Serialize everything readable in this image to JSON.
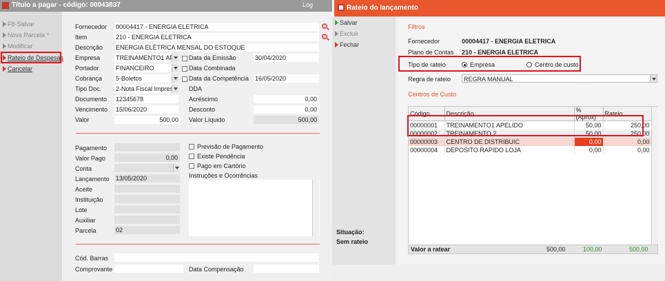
{
  "left": {
    "title": "Título a pagar - código: 00043837",
    "log": "Log",
    "sidebar": [
      {
        "label": "F8-Salvar",
        "state": "disabled"
      },
      {
        "label": "Nova Parcela *",
        "state": "disabled"
      },
      {
        "label": "Modificar",
        "state": "disabled"
      },
      {
        "label": "Rateio de Despesas",
        "state": "active"
      },
      {
        "label": "Cancelar",
        "state": "active"
      }
    ],
    "fornecedor_label": "Fornecedor",
    "fornecedor_value": "00004417 - ENERGIA ELETRICA",
    "item_label": "Item",
    "item_value": "210 - ENERGIA ELETRICA",
    "descricao_label": "Descrição",
    "descricao_value": "ENERGIA ELÉTRICA MENSAL DO ESTOQUE",
    "empresa_label": "Empresa",
    "empresa_value": "TREINAMENTO1 APE",
    "portador_label": "Portador",
    "portador_value": "FINANCEIRO",
    "cobranca_label": "Cobrança",
    "cobranca_value": "5-Boletos",
    "tipodoc_label": "Tipo Doc.",
    "tipodoc_value": "2-Nota Fiscal Impres",
    "documento_label": "Documento",
    "documento_value": "12345678",
    "vencimento_label": "Vencimento",
    "vencimento_value": "15/06/2020",
    "valor_label": "Valor",
    "valor_value": "500,00",
    "data_emissao_label": "Data da Emissão",
    "data_emissao_value": "30/04/2020",
    "data_combinada_label": "Data Combinada",
    "data_competencia_label": "Data da Competência",
    "data_competencia_value": "16/05/2020",
    "dda_label": "DDA",
    "acrescimo_label": "Acréscimo",
    "acrescimo_value": "0,00",
    "desconto_label": "Desconto",
    "desconto_value": "0,00",
    "valor_liquido_label": "Valor Líquido",
    "valor_liquido_value": "500,00",
    "pagamento_label": "Pagamento",
    "valor_pago_label": "Valor Pago",
    "valor_pago_value": "0,00",
    "conta_label": "Conta",
    "lancamento_label": "Lançamento",
    "lancamento_value": "13/05/2020",
    "aceite_label": "Aceite",
    "instituicao_label": "Instituição",
    "lote_label": "Lote",
    "auxiliar_label": "Auxiliar",
    "parcela_label": "Parcela",
    "parcela_value": "02",
    "previsao_label": "Previsão de Pagamento",
    "pendencia_label": "Existe Pendência",
    "cartorio_label": "Pago em Cartório",
    "instrucoes_label": "Instruções e Ocorrências",
    "cod_barras_label": "Cód. Barras",
    "comprovante_label": "Comprovante",
    "data_compensacao_label": "Data Compensação"
  },
  "right": {
    "title": "Rateio do lançamento",
    "sidebar": [
      {
        "label": "Salvar",
        "state": "active"
      },
      {
        "label": "Excluir",
        "state": "disabled"
      },
      {
        "label": "Fechar",
        "state": "active"
      }
    ],
    "filtros_label": "Filtros",
    "fornecedor_label": "Fornecedor",
    "fornecedor_value": "00004417 - ENERGIA ELETRICA",
    "plano_label": "Plano de Contas",
    "plano_value": "210 - ENERGIA ELETRICA",
    "tipo_rateio_label": "Tipo de rateio",
    "opt_empresa": "Empresa",
    "opt_centro": "Centro de custo",
    "tipo_rateio_selected": "Empresa",
    "regra_label": "Regra de rateio",
    "regra_value": "REGRA MANUAL",
    "centros_label": "Centros de Custo",
    "table": {
      "headers": [
        "Código",
        "Descrição",
        "% (Aprox)",
        "Rateio"
      ],
      "rows": [
        [
          "00000001",
          "TREINAMENTO1 APELIDO",
          "50,00",
          "250,00"
        ],
        [
          "00000002",
          "TREINAMENTO 2",
          "50,00",
          "250,00"
        ],
        [
          "00000003",
          "CENTRO DE DISTRIBUIC",
          "0,00",
          "0,00"
        ],
        [
          "00000004",
          "DEPOSITO RAPIDO LOJA",
          "0,00",
          "0,00"
        ]
      ]
    },
    "valor_a_ratear_label": "Valor a ratear",
    "valor_a_ratear_value": "500,00",
    "pct_total": "100,00",
    "rateio_total": "500,00",
    "situacao_label": "Situação:",
    "situacao_value": "Sem rateio",
    "colors": {
      "accent": "#e8572d",
      "highlight": "#e2111b",
      "green": "#2e8b2e"
    }
  }
}
